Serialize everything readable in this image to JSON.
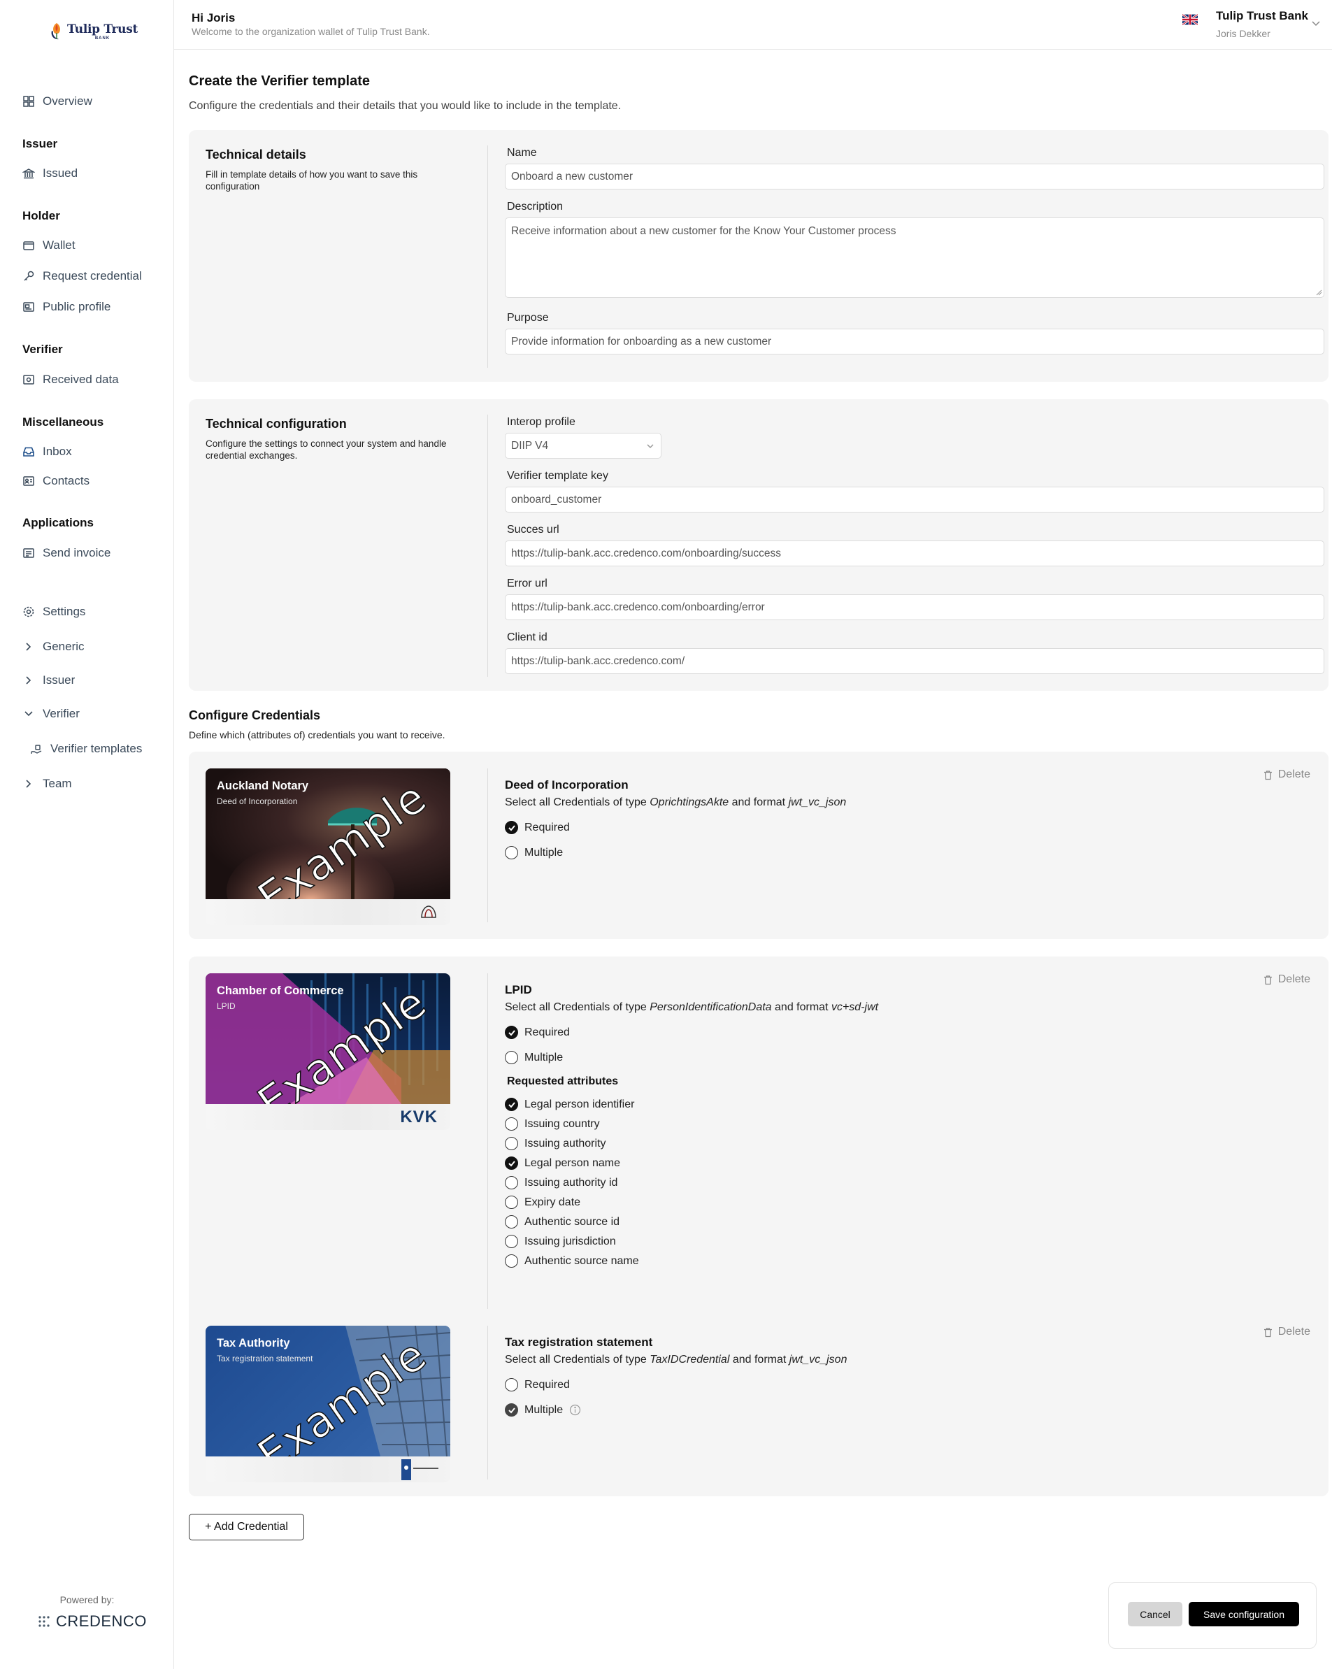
{
  "brand": {
    "logo_name": "Tulip Trust",
    "logo_sub": "BANK",
    "powered_by": "Powered by:",
    "vendor": "CREDENCO"
  },
  "header": {
    "greeting": "Hi Joris",
    "welcome": "Welcome to the organization wallet of Tulip Trust Bank.",
    "organization": "Tulip Trust Bank",
    "user": "Joris Dekker",
    "language_flag": "uk-flag-icon"
  },
  "sidebar": {
    "overview": "Overview",
    "issuer_heading": "Issuer",
    "issued": "Issued",
    "holder_heading": "Holder",
    "wallet": "Wallet",
    "request_credential": "Request credential",
    "public_profile": "Public profile",
    "verifier_heading": "Verifier",
    "received_data": "Received data",
    "misc_heading": "Miscellaneous",
    "inbox": "Inbox",
    "contacts": "Contacts",
    "applications_heading": "Applications",
    "send_invoice": "Send invoice",
    "settings": "Settings",
    "generic": "Generic",
    "issuer": "Issuer",
    "verifier": "Verifier",
    "verifier_templates": "Verifier templates",
    "team": "Team"
  },
  "page": {
    "title": "Create the Verifier template",
    "description": "Configure the credentials and their details that you would like to include in the template."
  },
  "technical_details": {
    "title": "Technical details",
    "subtitle": "Fill in template details of how you want to save this configuration",
    "name_label": "Name",
    "name_value": "Onboard a new customer",
    "description_label": "Description",
    "description_value": "Receive information about a new customer for the Know Your Customer process",
    "purpose_label": "Purpose",
    "purpose_value": "Provide information for onboarding as a new customer"
  },
  "technical_configuration": {
    "title": "Technical configuration",
    "subtitle": "Configure the settings to connect your system and handle credential exchanges.",
    "interop_label": "Interop profile",
    "interop_value": "DIIP V4",
    "key_label": "Verifier template key",
    "key_value": "onboard_customer",
    "success_label": "Succes url",
    "success_value": "https://tulip-bank.acc.credenco.com/onboarding/success",
    "error_label": "Error url",
    "error_value": "https://tulip-bank.acc.credenco.com/onboarding/error",
    "client_label": "Client id",
    "client_value": "https://tulip-bank.acc.credenco.com/"
  },
  "configure_credentials": {
    "title": "Configure Credentials",
    "description": "Define which (attributes of) credentials you want to receive.",
    "delete_label": "Delete",
    "select_prefix": "Select all Credentials of type",
    "and_format": "and format",
    "required_label": "Required",
    "multiple_label": "Multiple",
    "requested_attributes_label": "Requested attributes",
    "watermark": "Example",
    "credentials": [
      {
        "issuer": "Auckland Notary",
        "card_type": "Deed of Incorporation",
        "title": "Deed of Incorporation",
        "type": "OprichtingsAkte",
        "format": "jwt_vc_json",
        "required": true,
        "multiple": false
      },
      {
        "issuer": "Chamber of Commerce",
        "card_type": "LPID",
        "logo": "KVK",
        "title": "LPID",
        "type": "PersonIdentificationData",
        "format": "vc+sd-jwt",
        "required": true,
        "multiple": false,
        "attributes": [
          {
            "label": "Legal person identifier",
            "checked": true
          },
          {
            "label": "Issuing country",
            "checked": false
          },
          {
            "label": "Issuing authority",
            "checked": false
          },
          {
            "label": "Legal person name",
            "checked": true
          },
          {
            "label": "Issuing authority id",
            "checked": false
          },
          {
            "label": "Expiry date",
            "checked": false
          },
          {
            "label": "Authentic source id",
            "checked": false
          },
          {
            "label": "Issuing jurisdiction",
            "checked": false
          },
          {
            "label": "Authentic source name",
            "checked": false
          }
        ]
      },
      {
        "issuer": "Tax Authority",
        "card_type": "Tax registration statement",
        "title": "Tax registration statement",
        "type": "TaxIDCredential",
        "format": "jwt_vc_json",
        "required": false,
        "multiple": true
      }
    ]
  },
  "actions": {
    "add_credential": "+ Add Credential",
    "cancel": "Cancel",
    "save": "Save configuration"
  }
}
